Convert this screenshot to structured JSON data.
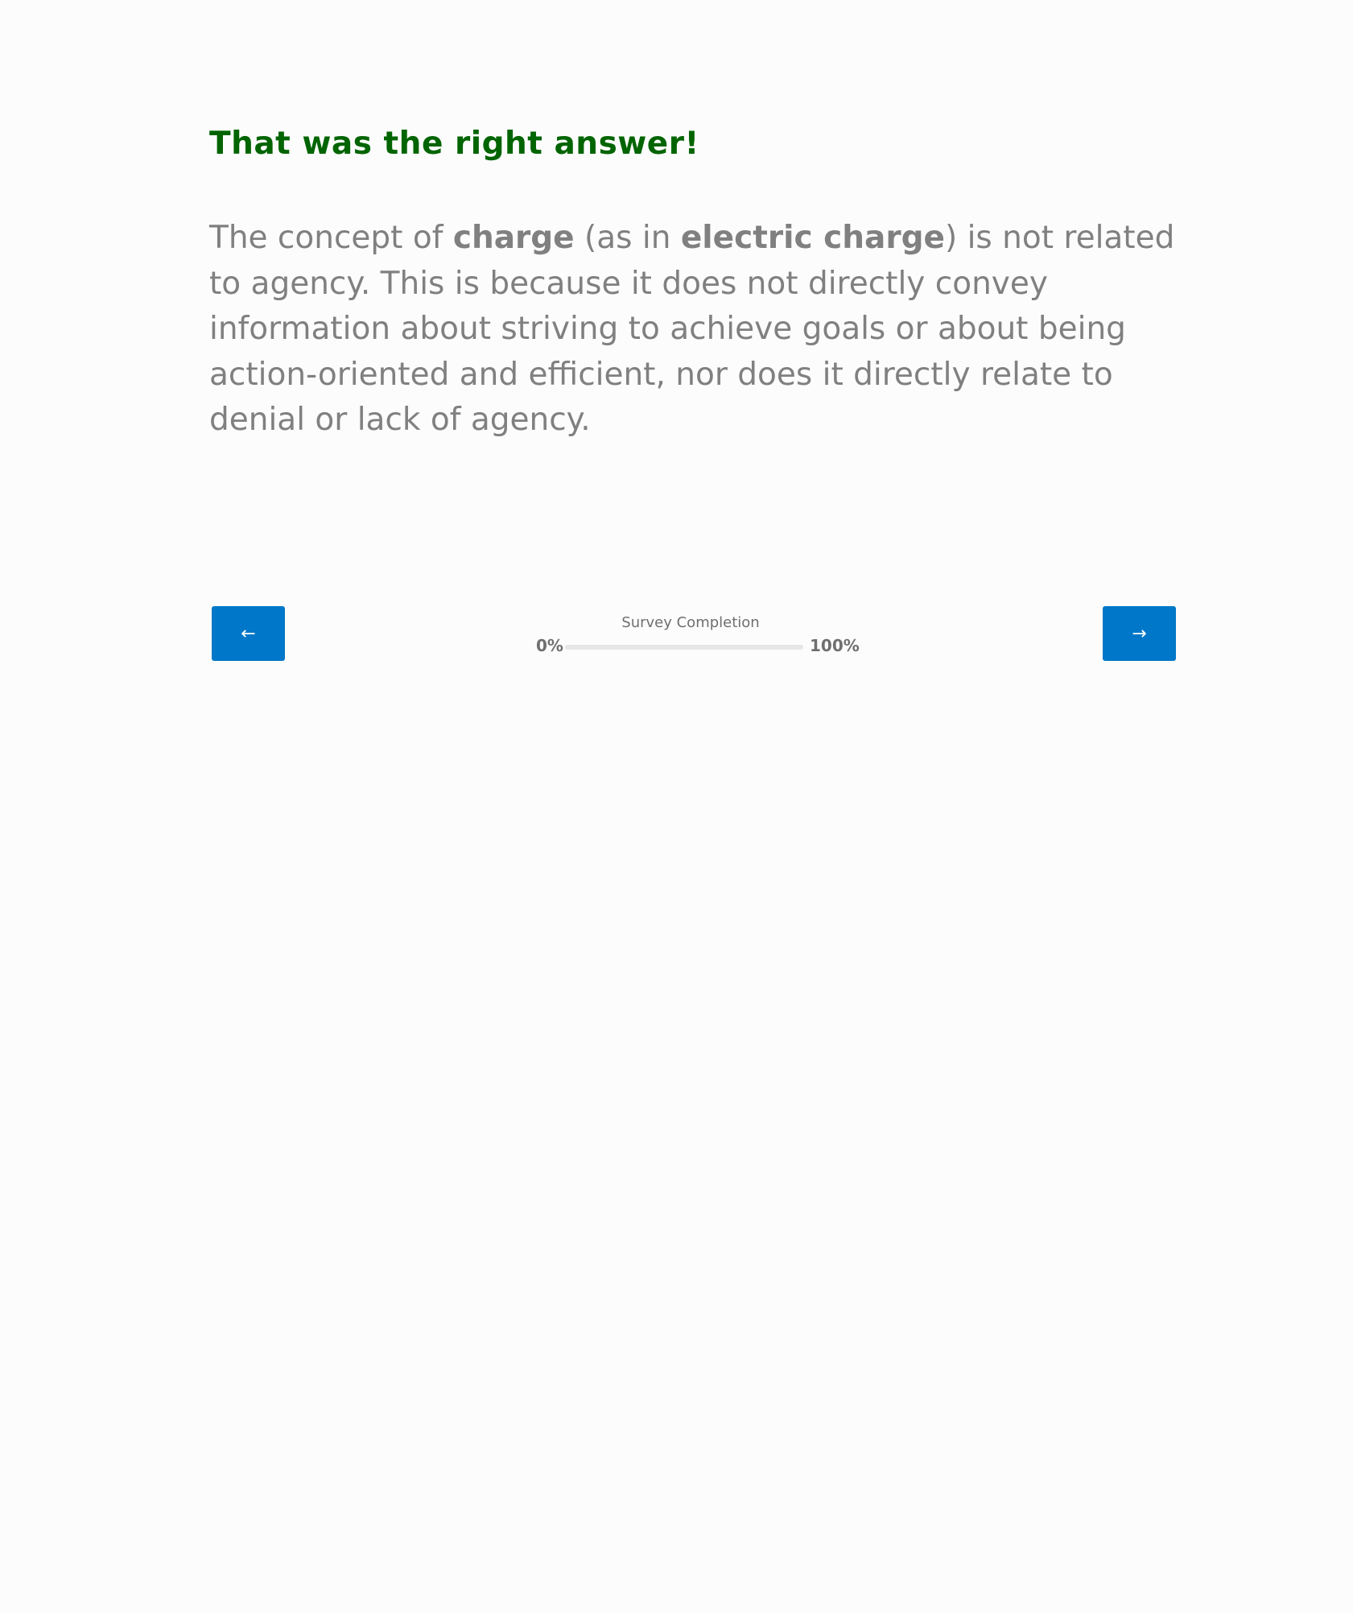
{
  "feedback": {
    "title": "That was the right answer!",
    "title_color": "#006400"
  },
  "explanation": {
    "seg1": "The concept of ",
    "bold1": "charge",
    "seg2": " (as in ",
    "bold2": "electric charge",
    "seg3": ") is not related to agency. This is because it does not directly convey information about striving to achieve goals or about being action-oriented and efficient, nor does it directly relate to denial or lack of agency."
  },
  "navigation": {
    "prev_icon": "←",
    "prev_icon_name": "arrow-left-icon",
    "next_icon": "→",
    "next_icon_name": "arrow-right-icon",
    "button_color": "#0077c8"
  },
  "progress": {
    "label": "Survey Completion",
    "min_label": "0%",
    "max_label": "100%",
    "value": 0
  }
}
